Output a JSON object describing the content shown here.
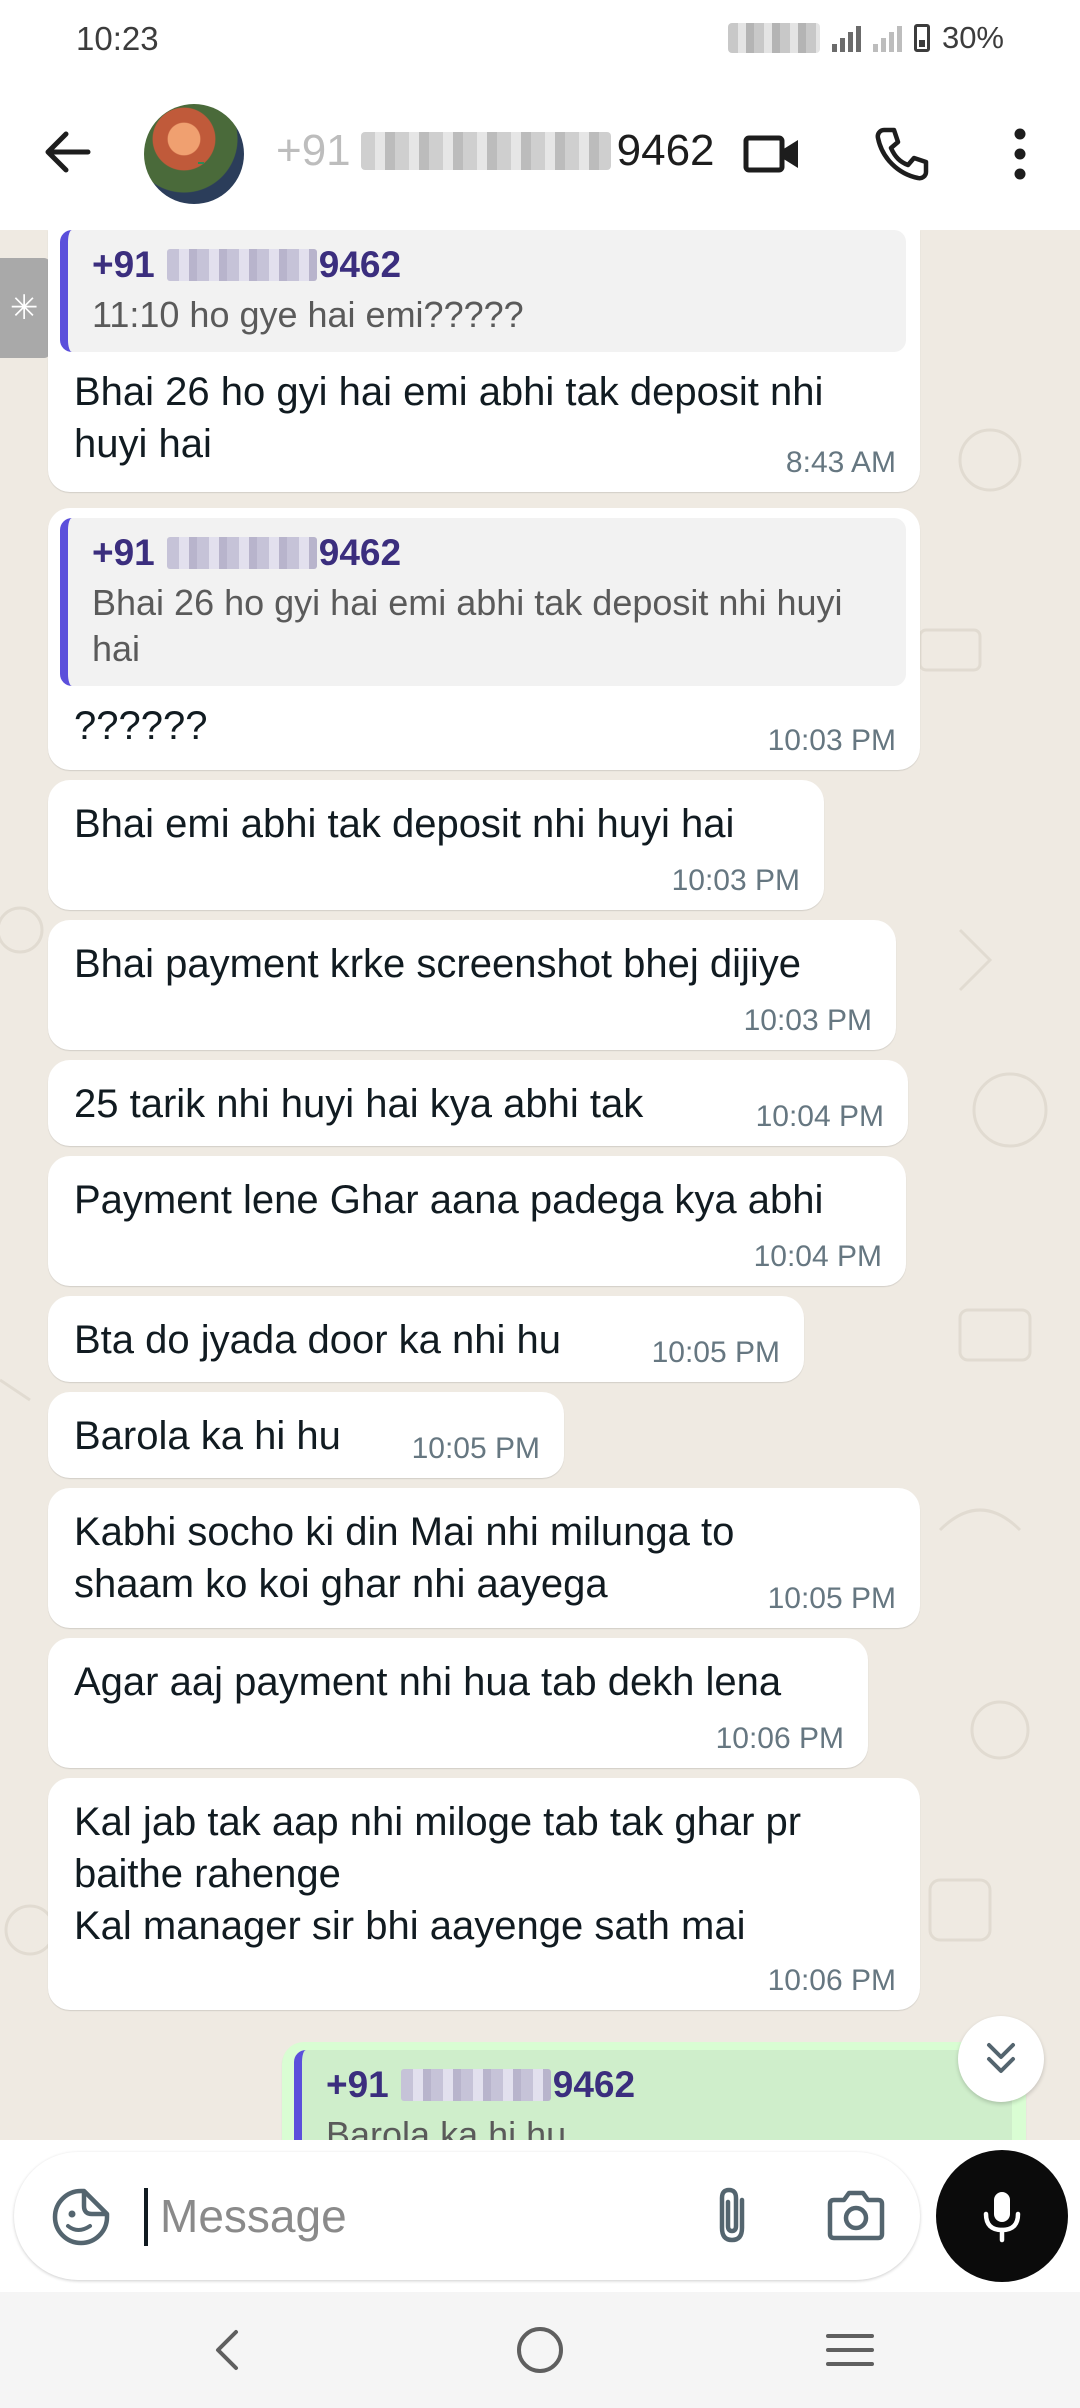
{
  "status_bar": {
    "time": "10:23",
    "battery": "30%"
  },
  "header": {
    "contact_suffix": "9462",
    "contact_prefix": "+91"
  },
  "messages": [
    {
      "quote_prefix": "+91",
      "quote_suffix": "9462",
      "quote_text": "11:10 ho gye hai emi?????",
      "text": "Bhai 26 ho gyi hai emi abhi tak deposit nhi huyi hai",
      "time": "8:43 AM"
    },
    {
      "quote_prefix": "+91",
      "quote_suffix": "9462",
      "quote_text": "Bhai 26 ho gyi hai emi abhi tak deposit nhi huyi hai",
      "text": "??????",
      "time": "10:03 PM"
    },
    {
      "text": "Bhai emi abhi tak deposit nhi huyi hai",
      "time": "10:03 PM"
    },
    {
      "text": "Bhai payment krke screenshot bhej dijiye",
      "time": "10:03 PM"
    },
    {
      "text": "25 tarik nhi huyi hai kya abhi tak",
      "time": "10:04 PM"
    },
    {
      "text": "Payment lene Ghar aana padega kya abhi",
      "time": "10:04 PM"
    },
    {
      "text": "Bta do jyada door ka nhi hu",
      "time": "10:05 PM"
    },
    {
      "text": "Barola ka hi hu",
      "time": "10:05 PM"
    },
    {
      "text": "Kabhi socho ki din Mai nhi milunga to shaam ko koi ghar nhi aayega",
      "time": "10:05 PM"
    },
    {
      "text": "Agar aaj payment nhi hua tab dekh lena",
      "time": "10:06 PM"
    },
    {
      "text": "Kal jab tak aap nhi miloge tab tak ghar pr baithe rahenge\nKal manager sir bhi aayenge sath mai",
      "time": "10:06 PM"
    },
    {
      "quote_prefix": "+91",
      "quote_suffix": "9462",
      "quote_text": "Barola ka hi hu"
    }
  ],
  "composer": {
    "placeholder": "Message"
  },
  "icons": {
    "back": "arrow-left-icon",
    "video": "video-call-icon",
    "call": "phone-icon",
    "menu": "more-vert-icon",
    "emoji": "sticker-icon",
    "attach": "paperclip-icon",
    "camera": "camera-icon",
    "mic": "mic-icon",
    "scroll": "double-chevron-down-icon"
  },
  "colors": {
    "chat_bg": "#efeae2",
    "bubble_in": "#ffffff",
    "bubble_out": "#d9fdd3",
    "quote_bar": "#5b4fdb"
  }
}
